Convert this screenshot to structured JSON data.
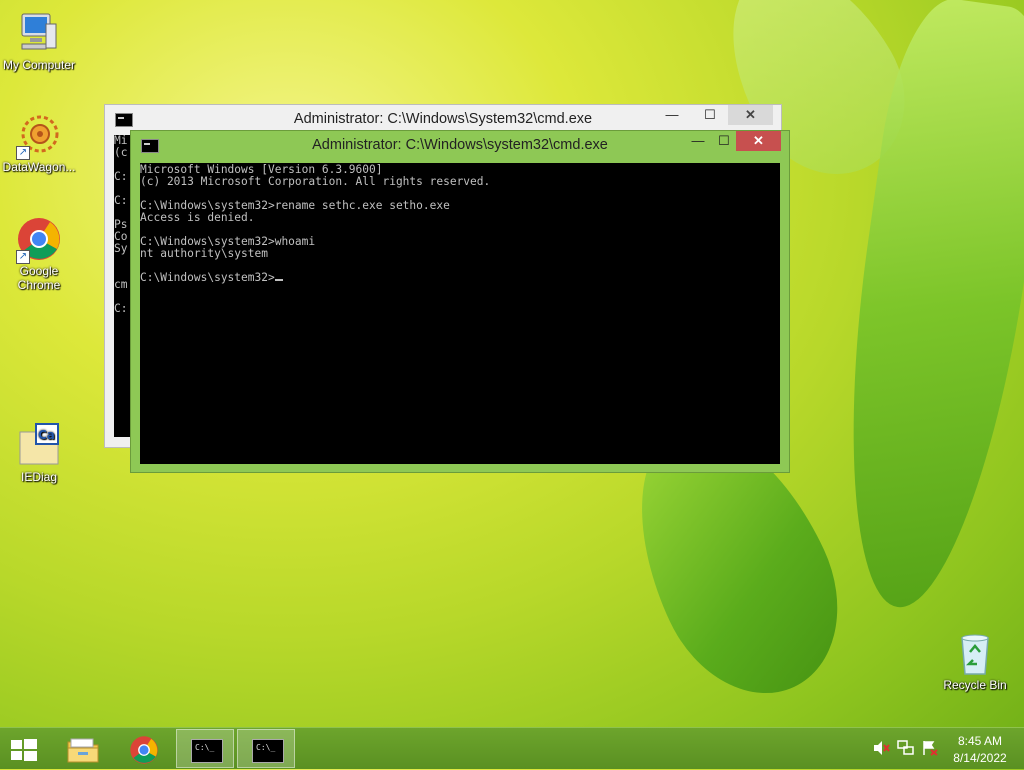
{
  "desktop": {
    "icons": [
      {
        "label": "My Computer"
      },
      {
        "label": "DataWagon..."
      },
      {
        "label": "Google Chrome"
      },
      {
        "label": "IEDiag"
      },
      {
        "label": "Recycle Bin"
      }
    ]
  },
  "back_window": {
    "title": "Administrator: C:\\Windows\\System32\\cmd.exe",
    "console_text": "Mi\n(c\n\nC:\n\nC:\n\nPs\nCo\nSy\n\n\ncm\n\nC:"
  },
  "front_window": {
    "title": "Administrator: C:\\Windows\\system32\\cmd.exe",
    "console_text": "Microsoft Windows [Version 6.3.9600]\n(c) 2013 Microsoft Corporation. All rights reserved.\n\nC:\\Windows\\system32>rename sethc.exe setho.exe\nAccess is denied.\n\nC:\\Windows\\system32>whoami\nnt authority\\system\n\nC:\\Windows\\system32>"
  },
  "window_controls": {
    "minimize": "—",
    "maximize": "☐",
    "close": "✕"
  },
  "taskbar": {
    "cmd_icon_text": "C:\\_",
    "clock_time": "8:45 AM",
    "clock_date": "8/14/2022"
  },
  "icons": [
    "computer-icon",
    "datawagon-icon",
    "chrome-icon",
    "iediag-icon",
    "recycle-bin-icon",
    "windows-logo-icon",
    "file-explorer-icon",
    "speaker-muted-icon",
    "network-icon",
    "action-center-icon"
  ]
}
